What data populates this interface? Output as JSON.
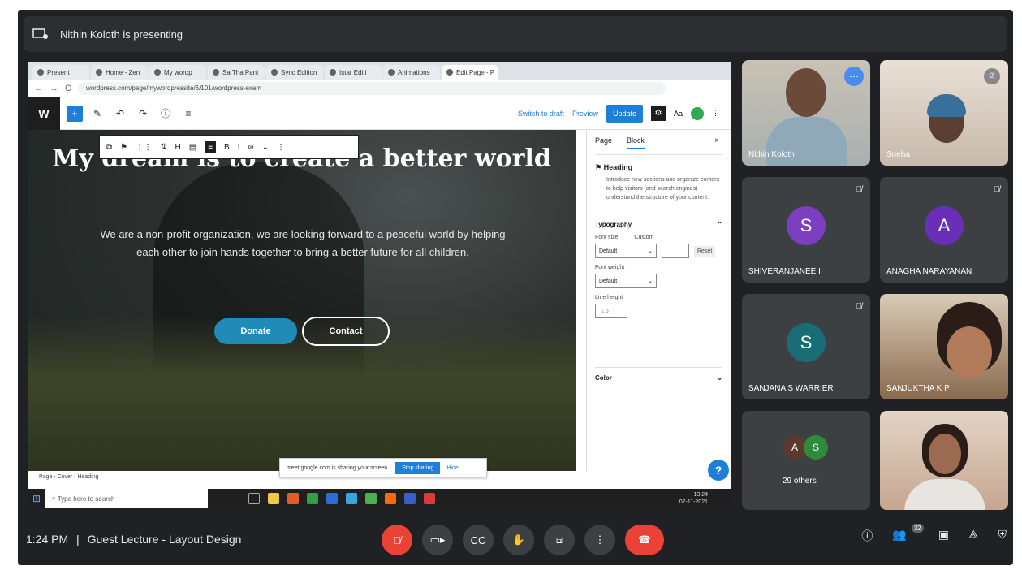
{
  "meet": {
    "presenting_text": "Nithin Koloth is presenting",
    "time": "1:24 PM",
    "separator": "|",
    "meeting_name": "Guest Lecture - Layout Design",
    "people_count": "32"
  },
  "browser": {
    "tabs": [
      "Present",
      "Home - Zen",
      "My wordp",
      "Sa Tha Pani",
      "Sync Edition",
      "Istar Editi",
      "Animations",
      "Edit Page - P"
    ],
    "url": "wordpress.com/page/mywordpressite/6/101/wordpress-exam",
    "nav_back": "←",
    "nav_fwd": "→",
    "reload": "C"
  },
  "wp": {
    "logo": "W",
    "add_block": "+",
    "save_draft": "Switch to draft",
    "preview": "Preview",
    "update": "Update",
    "heading": "My dream is to create a better world",
    "paragraph": "We are a non-profit organization, we are looking forward to a peaceful world by helping each other to join hands together to bring a better future for all children.",
    "donate": "Donate",
    "contact": "Contact",
    "breadcrumb": "Page  ›  Cover  ›  Heading",
    "sidebar": {
      "tab_page": "Page",
      "tab_block": "Block",
      "close": "×",
      "block_name": "Heading",
      "block_desc": "Introduce new sections and organize content to help visitors (and search engines) understand the structure of your content.",
      "typography": "Typography",
      "font_size_label": "Font size",
      "custom_label": "Custom",
      "font_size_value": "Default",
      "reset": "Reset",
      "font_weight_label": "Font weight",
      "font_weight_value": "Default",
      "line_height_label": "Line height",
      "line_height_value": "1.5",
      "color": "Color"
    },
    "notification": "meet.google.com is sharing your screen.",
    "stop_sharing": "Stop sharing",
    "hide": "Hide"
  },
  "taskbar": {
    "search": "Type here to search",
    "clock_time": "13:24",
    "clock_date": "07-11-2021"
  },
  "participants": [
    {
      "name": "Nithin Koloth",
      "type": "video"
    },
    {
      "name": "Sneha",
      "type": "video"
    },
    {
      "name": "SHIVERANJANEE I",
      "type": "avatar",
      "initial": "S",
      "color": "#7b3fbf"
    },
    {
      "name": "ANAGHA NARAYANAN",
      "type": "avatar",
      "initial": "A",
      "color": "#6a2fb8"
    },
    {
      "name": "SANJANA S WARRIER",
      "type": "avatar",
      "initial": "S",
      "color": "#1a6c76"
    },
    {
      "name": "SANJUKTHA K P",
      "type": "video"
    },
    {
      "name": "29 others",
      "type": "others",
      "initials": [
        "A",
        "S"
      ],
      "colors": [
        "#5b3a2e",
        "#2e8b3a"
      ]
    },
    {
      "name": "",
      "type": "video"
    }
  ],
  "colors": {
    "meet_bg": "#202124",
    "tile_bg": "#3c4043",
    "wp_blue": "#1e7fd6",
    "end_call": "#ea4335"
  }
}
